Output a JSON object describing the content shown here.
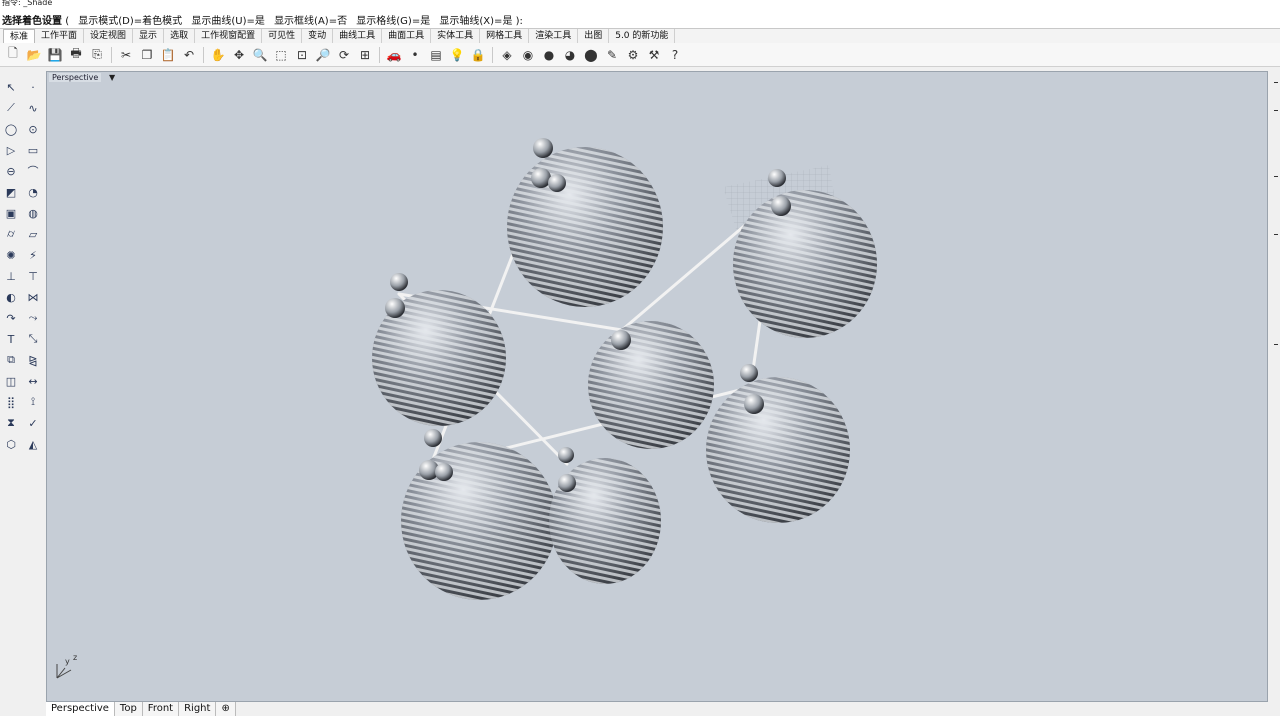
{
  "command": {
    "history": "指令: _Shade",
    "prompt": "选择着色设置",
    "open_paren": "(",
    "options": [
      "显示模式(D)=着色模式",
      "显示曲线(U)=是",
      "显示框线(A)=否",
      "显示格线(G)=是",
      "显示轴线(X)=是"
    ],
    "close_paren": "):"
  },
  "tabs": [
    "标准",
    "工作平面",
    "设定视图",
    "显示",
    "选取",
    "工作视窗配置",
    "可见性",
    "变动",
    "曲线工具",
    "曲面工具",
    "实体工具",
    "网格工具",
    "渲染工具",
    "出图",
    "5.0 的新功能"
  ],
  "active_tab": "标准",
  "toolbar_icons": [
    {
      "name": "new-file-icon",
      "glyph": "🗋"
    },
    {
      "name": "open-folder-icon",
      "glyph": "📂"
    },
    {
      "name": "save-icon",
      "glyph": "💾"
    },
    {
      "name": "print-icon",
      "glyph": "🖶"
    },
    {
      "name": "import-icon",
      "glyph": "⎘"
    },
    {
      "name": "cut-icon",
      "glyph": "✂"
    },
    {
      "name": "copy-icon",
      "glyph": "❐"
    },
    {
      "name": "paste-icon",
      "glyph": "📋"
    },
    {
      "name": "undo-icon",
      "glyph": "↶"
    },
    {
      "name": "pan-hand-icon",
      "glyph": "✋"
    },
    {
      "name": "move-icon",
      "glyph": "✥"
    },
    {
      "name": "zoom-icon",
      "glyph": "🔍"
    },
    {
      "name": "zoom-window-icon",
      "glyph": "⬚"
    },
    {
      "name": "zoom-extents-icon",
      "glyph": "⊡"
    },
    {
      "name": "zoom-selected-icon",
      "glyph": "🔎"
    },
    {
      "name": "rotate-view-icon",
      "glyph": "⟳"
    },
    {
      "name": "viewport-grid-icon",
      "glyph": "⊞"
    },
    {
      "name": "car-icon",
      "glyph": "🚗"
    },
    {
      "name": "point-icon",
      "glyph": "•"
    },
    {
      "name": "layer-icon",
      "glyph": "▤"
    },
    {
      "name": "light-bulb-icon",
      "glyph": "💡"
    },
    {
      "name": "lock-icon",
      "glyph": "🔒"
    },
    {
      "name": "render-icon",
      "glyph": "◈"
    },
    {
      "name": "color-wheel-icon",
      "glyph": "◉"
    },
    {
      "name": "sphere-shade-icon",
      "glyph": "●"
    },
    {
      "name": "sphere-render-icon",
      "glyph": "◕"
    },
    {
      "name": "sphere-blue-icon",
      "glyph": "⬤"
    },
    {
      "name": "brush-icon",
      "glyph": "✎"
    },
    {
      "name": "settings-gear-icon",
      "glyph": "⚙"
    },
    {
      "name": "options-icon",
      "glyph": "⚒"
    },
    {
      "name": "help-icon",
      "glyph": "?"
    }
  ],
  "left_tools": [
    {
      "name": "select-arrow-icon",
      "glyph": "↖"
    },
    {
      "name": "point-tool-icon",
      "glyph": "·"
    },
    {
      "name": "polyline-icon",
      "glyph": "⟋"
    },
    {
      "name": "curve-control-icon",
      "glyph": "∿"
    },
    {
      "name": "circle-icon",
      "glyph": "◯"
    },
    {
      "name": "arc-icon",
      "glyph": "⊙"
    },
    {
      "name": "polygon-icon",
      "glyph": "▷"
    },
    {
      "name": "rectangle-icon",
      "glyph": "▭"
    },
    {
      "name": "ellipse-icon",
      "glyph": "⊖"
    },
    {
      "name": "freeform-curve-icon",
      "glyph": "⌒"
    },
    {
      "name": "surface-corner-icon",
      "glyph": "◩"
    },
    {
      "name": "extrude-curve-icon",
      "glyph": "◔"
    },
    {
      "name": "box-solid-icon",
      "glyph": "▣"
    },
    {
      "name": "sphere-solid-icon",
      "glyph": "◍"
    },
    {
      "name": "cylinder-icon",
      "glyph": "⌭"
    },
    {
      "name": "mesh-plane-icon",
      "glyph": "▱"
    },
    {
      "name": "gear-solid-icon",
      "glyph": "✺"
    },
    {
      "name": "lightning-edit-icon",
      "glyph": "⚡"
    },
    {
      "name": "extend-icon",
      "glyph": "⊥"
    },
    {
      "name": "trim-icon",
      "glyph": "⊤"
    },
    {
      "name": "boolean-icon",
      "glyph": "◐"
    },
    {
      "name": "join-icon",
      "glyph": "⋈"
    },
    {
      "name": "fillet-curve-icon",
      "glyph": "↷"
    },
    {
      "name": "offset-icon",
      "glyph": "⤳"
    },
    {
      "name": "text-icon",
      "glyph": "T"
    },
    {
      "name": "scale-icon",
      "glyph": "⤡"
    },
    {
      "name": "group-icon",
      "glyph": "⧉"
    },
    {
      "name": "mirror-icon",
      "glyph": "⧎"
    },
    {
      "name": "block-icon",
      "glyph": "◫"
    },
    {
      "name": "dimension-icon",
      "glyph": "↔"
    },
    {
      "name": "array-icon",
      "glyph": "⣿"
    },
    {
      "name": "analyze-icon",
      "glyph": "⟟"
    },
    {
      "name": "transform-icon",
      "glyph": "⧗"
    },
    {
      "name": "check-icon",
      "glyph": "✓"
    },
    {
      "name": "shape-mesh-icon",
      "glyph": "⬡"
    },
    {
      "name": "paint-bucket-icon",
      "glyph": "◭"
    }
  ],
  "viewport": {
    "title": "Perspective",
    "menu_arrow": "▼",
    "axis_y": "y",
    "axis_z": "z",
    "background": "#c6cdd6",
    "object_color": "#7d8390"
  },
  "bottom_tabs": [
    "Perspective",
    "Top",
    "Front",
    "Right",
    "⊕"
  ],
  "active_bottom_tab": "Perspective"
}
